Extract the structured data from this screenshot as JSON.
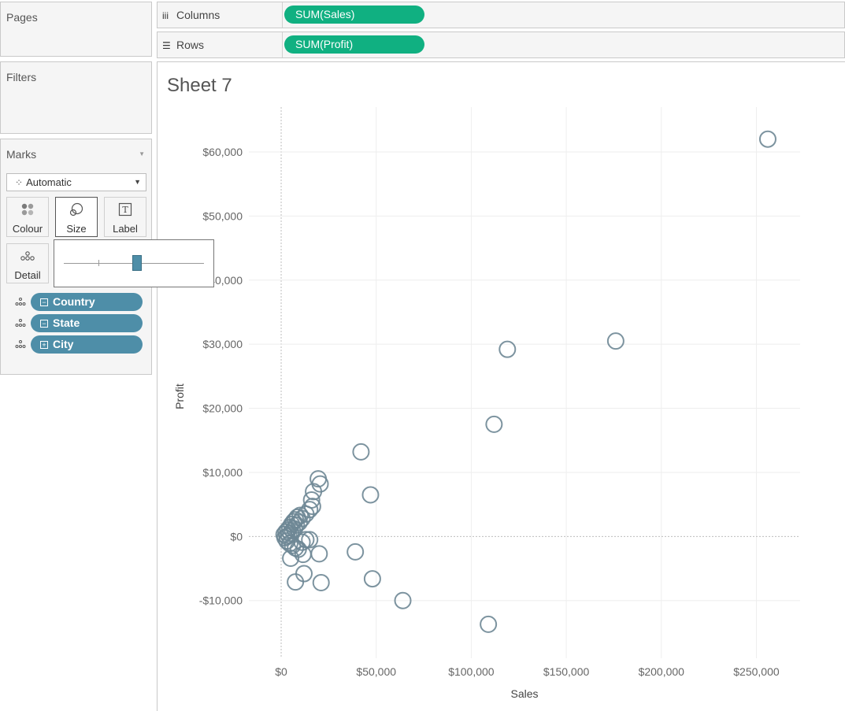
{
  "cards": {
    "pages": "Pages",
    "filters": "Filters",
    "marks": "Marks"
  },
  "shelves": {
    "columns": {
      "label": "Columns",
      "pill": "SUM(Sales)"
    },
    "rows": {
      "label": "Rows",
      "pill": "SUM(Profit)"
    }
  },
  "marks": {
    "type": "Automatic",
    "buttons": {
      "colour": "Colour",
      "size": "Size",
      "label": "Label",
      "detail": "Detail"
    },
    "size_slider_fraction": 0.52,
    "fields": [
      {
        "name": "Country",
        "expand": "minus"
      },
      {
        "name": "State",
        "expand": "minus"
      },
      {
        "name": "City",
        "expand": "plus"
      }
    ]
  },
  "sheet": {
    "title": "Sheet 7"
  },
  "colors": {
    "pill_green": "#10b081",
    "pill_blue": "#4e8ea8",
    "mark_stroke": "#6e8795"
  },
  "chart_data": {
    "type": "scatter",
    "xlabel": "Sales",
    "ylabel": "Profit",
    "xlim": [
      -17000,
      273000
    ],
    "ylim": [
      -19000,
      67000
    ],
    "x_ticks": [
      0,
      50000,
      100000,
      150000,
      200000,
      250000
    ],
    "x_tick_labels": [
      "$0",
      "$50,000",
      "$100,000",
      "$150,000",
      "$200,000",
      "$250,000"
    ],
    "y_ticks": [
      -10000,
      0,
      10000,
      20000,
      30000,
      40000,
      50000,
      60000
    ],
    "y_tick_labels": [
      "-$10,000",
      "$0",
      "$10,000",
      "$20,000",
      "$30,000",
      "$40,000",
      "$50,000",
      "$60,000"
    ],
    "grid": true,
    "points": [
      {
        "x": 256000,
        "y": 62000
      },
      {
        "x": 176000,
        "y": 30500
      },
      {
        "x": 119000,
        "y": 29200
      },
      {
        "x": 112000,
        "y": 17500
      },
      {
        "x": 42000,
        "y": 13200
      },
      {
        "x": 47000,
        "y": 6500
      },
      {
        "x": 19500,
        "y": 9000
      },
      {
        "x": 20500,
        "y": 8200
      },
      {
        "x": 17000,
        "y": 7000
      },
      {
        "x": 16000,
        "y": 5700
      },
      {
        "x": 16500,
        "y": 4700
      },
      {
        "x": 15000,
        "y": 4200
      },
      {
        "x": 13000,
        "y": 3500
      },
      {
        "x": 11000,
        "y": 2800
      },
      {
        "x": 9500,
        "y": 2200
      },
      {
        "x": 8000,
        "y": 1800
      },
      {
        "x": 7000,
        "y": 1200
      },
      {
        "x": 6000,
        "y": 900
      },
      {
        "x": 5000,
        "y": 500
      },
      {
        "x": 4000,
        "y": 200
      },
      {
        "x": 3000,
        "y": 0
      },
      {
        "x": 2000,
        "y": -200
      },
      {
        "x": 1500,
        "y": 300
      },
      {
        "x": 2500,
        "y": 700
      },
      {
        "x": 3500,
        "y": 1000
      },
      {
        "x": 4500,
        "y": 1400
      },
      {
        "x": 5500,
        "y": 1900
      },
      {
        "x": 6500,
        "y": 2300
      },
      {
        "x": 7500,
        "y": 2600
      },
      {
        "x": 8500,
        "y": 3000
      },
      {
        "x": 10000,
        "y": 3300
      },
      {
        "x": 3000,
        "y": -700
      },
      {
        "x": 4500,
        "y": -1100
      },
      {
        "x": 6000,
        "y": -1400
      },
      {
        "x": 7500,
        "y": -1800
      },
      {
        "x": 9000,
        "y": -2000
      },
      {
        "x": 11000,
        "y": -900
      },
      {
        "x": 13000,
        "y": -500
      },
      {
        "x": 15000,
        "y": -500
      },
      {
        "x": 5000,
        "y": -3400
      },
      {
        "x": 11500,
        "y": -2800
      },
      {
        "x": 20000,
        "y": -2700
      },
      {
        "x": 39000,
        "y": -2400
      },
      {
        "x": 12000,
        "y": -5800
      },
      {
        "x": 7500,
        "y": -7100
      },
      {
        "x": 21000,
        "y": -7200
      },
      {
        "x": 48000,
        "y": -6600
      },
      {
        "x": 64000,
        "y": -10000
      },
      {
        "x": 109000,
        "y": -13700
      }
    ]
  }
}
